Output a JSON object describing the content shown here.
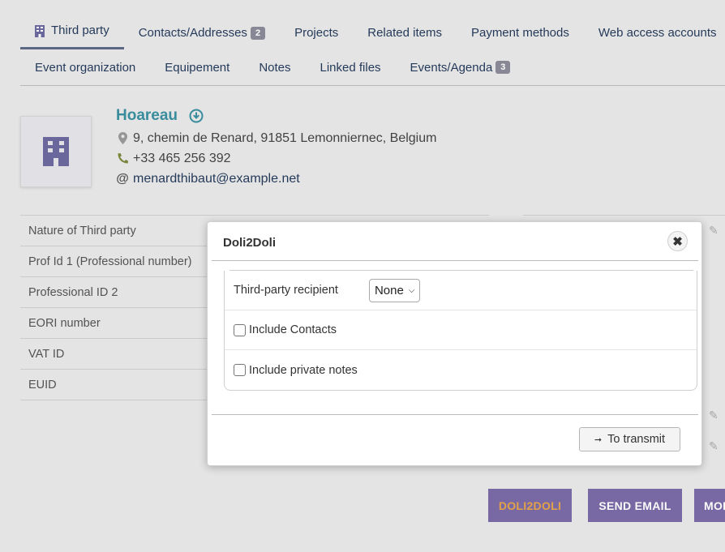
{
  "tabs": {
    "row1": [
      {
        "label": "Third party",
        "active": true
      },
      {
        "label": "Contacts/Addresses",
        "badge": "2"
      },
      {
        "label": "Projects"
      },
      {
        "label": "Related items"
      },
      {
        "label": "Payment methods"
      },
      {
        "label": "Web access accounts"
      }
    ],
    "row2": [
      {
        "label": "Event organization"
      },
      {
        "label": "Equipement"
      },
      {
        "label": "Notes"
      },
      {
        "label": "Linked files"
      },
      {
        "label": "Events/Agenda",
        "badge": "3"
      }
    ]
  },
  "company": {
    "name": "Hoareau",
    "address": "9, chemin de Renard, 91851 Lemonniernec, Belgium",
    "phone": "+33 465 256 392",
    "email": "menardthibaut@example.net"
  },
  "fields": [
    "Nature of Third party",
    "Prof Id 1 (Professional number)",
    "Professional ID 2",
    "EORI number",
    "VAT ID",
    "EUID"
  ],
  "actions": {
    "doli2doli": "DOLI2DOLI",
    "send_email": "SEND EMAIL",
    "more": "MOI"
  },
  "dialog": {
    "title": "Doli2Doli",
    "close_symbol": "✖",
    "recipient_label": "Third-party recipient",
    "recipient_value": "None",
    "include_contacts": "Include Contacts",
    "include_private_notes": "Include private notes",
    "transmit_label": "To transmit"
  },
  "colors": {
    "tab_text": "#263c5c",
    "company_name": "#3a8fa0",
    "button_bg": "#7b6ba8",
    "doli_button_text": "#e8a64a"
  },
  "icons": {
    "third_party_tab": "building-icon",
    "download": "download-circle-icon",
    "address": "map-marker-icon",
    "phone": "phone-icon",
    "email": "at-sign-icon",
    "edit": "pencil-icon"
  }
}
